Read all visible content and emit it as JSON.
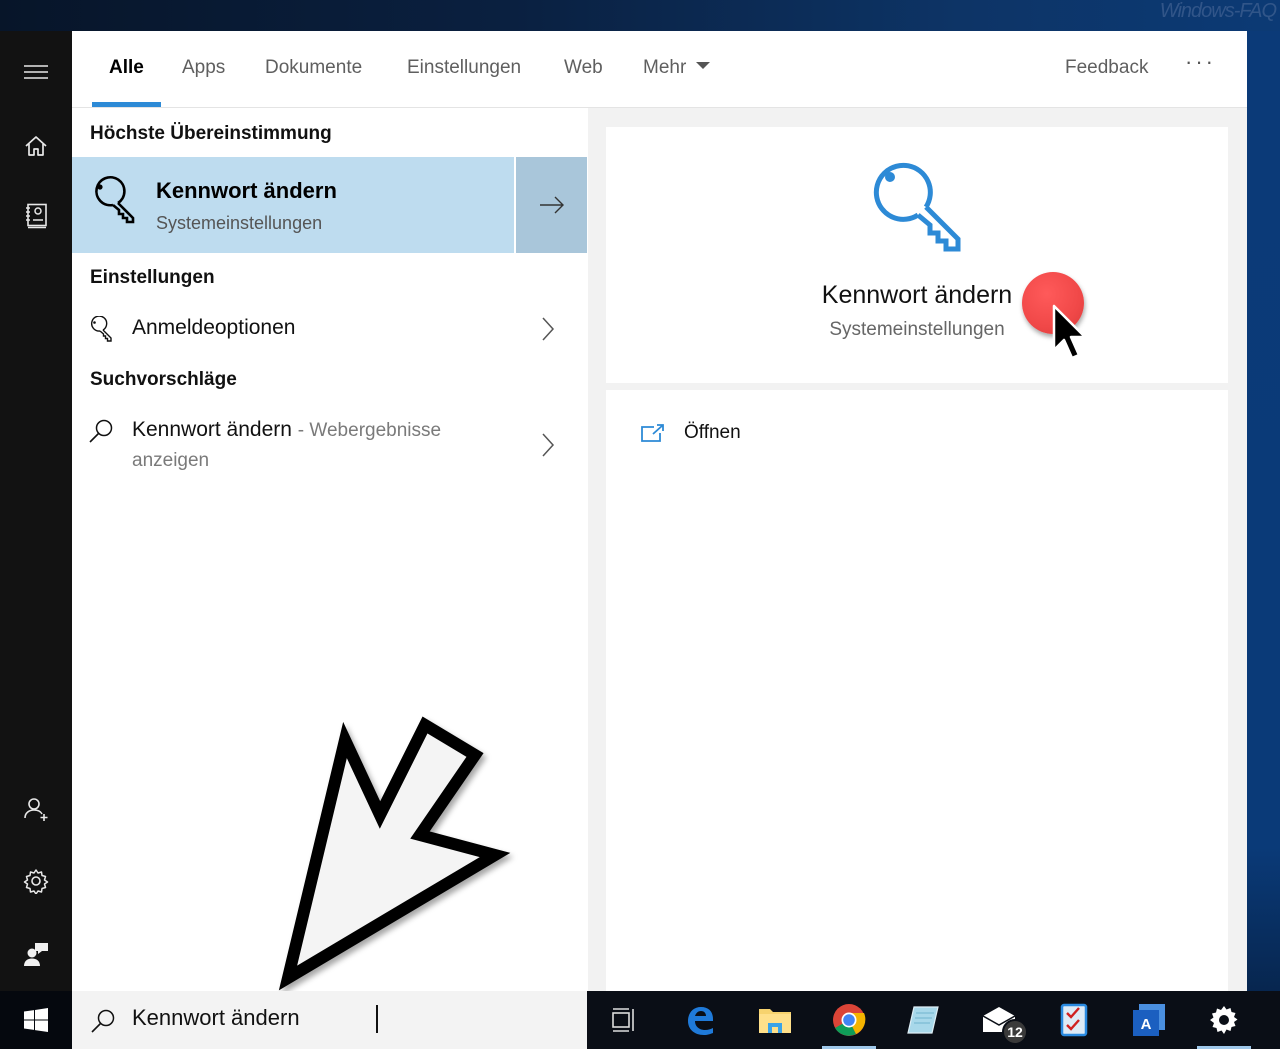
{
  "desktop": {
    "watermark": "Windows-FAQ"
  },
  "rail": {
    "items": [
      {
        "name": "menu-icon",
        "label": "Menu"
      },
      {
        "name": "home-icon",
        "label": "Home"
      },
      {
        "name": "notebook-icon",
        "label": "Notebook"
      },
      {
        "name": "add-user-icon",
        "label": "Account"
      },
      {
        "name": "gear-icon",
        "label": "Settings"
      },
      {
        "name": "feedback-person-icon",
        "label": "Feedback"
      }
    ]
  },
  "tabs": {
    "items": [
      {
        "label": "Alle",
        "active": true
      },
      {
        "label": "Apps",
        "active": false
      },
      {
        "label": "Dokumente",
        "active": false
      },
      {
        "label": "Einstellungen",
        "active": false
      },
      {
        "label": "Web",
        "active": false
      },
      {
        "label": "Mehr",
        "active": false,
        "dropdown": true
      }
    ],
    "feedback_label": "Feedback",
    "more_options": "···",
    "accent_color": "#2d8ad6"
  },
  "results": {
    "best_match_heading": "Höchste Übereinstimmung",
    "best_match": {
      "title": "Kennwort ändern",
      "subtitle": "Systemeinstellungen",
      "icon": "key-icon",
      "highlight_color": "#bedcef"
    },
    "settings_heading": "Einstellungen",
    "settings_items": [
      {
        "title": "Anmeldeoptionen",
        "icon": "key-icon"
      }
    ],
    "suggestions_heading": "Suchvorschläge",
    "suggestion_items": [
      {
        "title": "Kennwort ändern",
        "suffix": "- Webergebnisse",
        "subtitle": "anzeigen",
        "icon": "search-icon"
      }
    ]
  },
  "preview": {
    "title": "Kennwort ändern",
    "subtitle": "Systemeinstellungen",
    "icon": "key-icon",
    "icon_color": "#2d8ad6",
    "actions": [
      {
        "label": "Öffnen",
        "icon": "open-external-icon"
      }
    ]
  },
  "search": {
    "value": "Kennwort ändern",
    "icon": "search-icon"
  },
  "taskbar": {
    "items": [
      {
        "name": "task-view",
        "icon": "task-view-icon",
        "active": false
      },
      {
        "name": "edge",
        "icon": "edge-icon",
        "active": false
      },
      {
        "name": "file-explorer",
        "icon": "folder-icon",
        "active": false
      },
      {
        "name": "chrome",
        "icon": "chrome-icon",
        "active": true
      },
      {
        "name": "notepad",
        "icon": "notepad-icon",
        "active": false
      },
      {
        "name": "mail",
        "icon": "mail-icon",
        "active": false,
        "badge": "12"
      },
      {
        "name": "checklist",
        "icon": "checklist-icon",
        "active": false
      },
      {
        "name": "acronis",
        "icon": "acronis-icon",
        "active": false
      },
      {
        "name": "settings",
        "icon": "gear-icon",
        "active": true
      }
    ]
  }
}
